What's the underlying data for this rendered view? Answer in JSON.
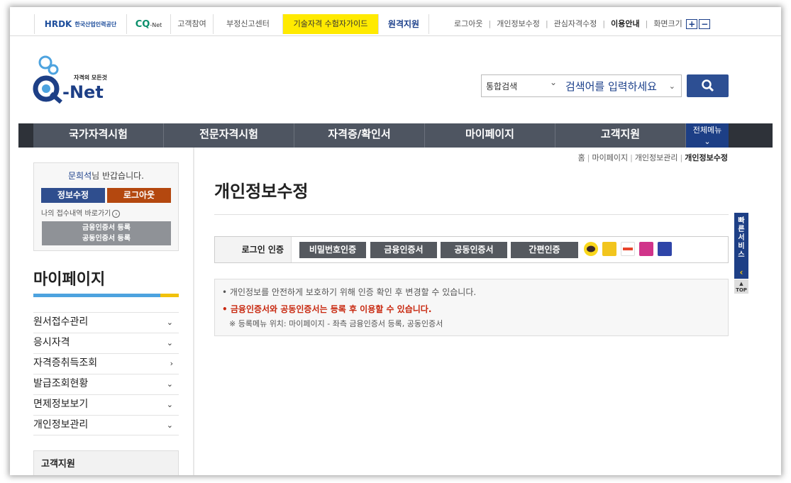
{
  "topbar": {
    "hrdk_mark": "HRDK",
    "hrdk_name": "한국산업인력공단",
    "cqnet": "CQ",
    "cqnet_suffix": "-Net",
    "links": [
      "고객참여",
      "부정신고센터"
    ],
    "guide": "기술자격 수험자가이드",
    "onsite": "원격지원",
    "util": [
      "로그아웃",
      "개인정보수정",
      "관심자격수정"
    ],
    "util_bold": "이용안내",
    "zoom_label": "화면크기",
    "zoom_in": "+",
    "zoom_out": "−"
  },
  "header": {
    "logo_tagline": "자격의 모든것",
    "logo_text": "-Net",
    "search_category": "통합검색",
    "search_placeholder": "검색어를 입력하세요"
  },
  "gnb": {
    "items": [
      "국가자격시험",
      "전문자격시험",
      "자격증/확인서",
      "마이페이지",
      "고객지원"
    ],
    "all_menu": "전체메뉴"
  },
  "userbox": {
    "user_name": "문희석",
    "greeting": "님 반갑습니다.",
    "info_button": "정보수정",
    "logout_button": "로그아웃",
    "goto_text": "나의 접수내역 바로가기",
    "cert_line1": "금융인증서 등록",
    "cert_line2": "공동인증서 등록"
  },
  "sidebar": {
    "title": "마이페이지",
    "items": [
      {
        "label": "원서접수관리",
        "arrow": "⌄"
      },
      {
        "label": "응시자격",
        "arrow": "⌄"
      },
      {
        "label": "자격증취득조회",
        "arrow": "›"
      },
      {
        "label": "발급조회현황",
        "arrow": "⌄"
      },
      {
        "label": "면제정보보기",
        "arrow": "⌄"
      },
      {
        "label": "개인정보관리",
        "arrow": "⌄"
      }
    ],
    "cs_title": "고객지원"
  },
  "breadcrumb": {
    "items": [
      "홈",
      "마이페이지",
      "개인정보관리"
    ],
    "current": "개인정보수정"
  },
  "main": {
    "title": "개인정보수정",
    "auth_label": "로그인 인증",
    "auth_buttons": [
      "비밀번호인증",
      "금융인증서",
      "공동인증서",
      "간편인증"
    ],
    "auth_icons": [
      "kakao-icon",
      "kb-icon",
      "payco-icon",
      "pass-icon",
      "samsung-pass-icon"
    ],
    "notice1": "개인정보를 안전하게 보호하기 위해 인증 확인 후 변경할 수 있습니다.",
    "notice2": "금융인증서와 공동인증서는 등록 후 이용할 수 있습니다.",
    "notice3": "※ 등록메뉴 위치: 마이페이지 - 좌측 금융인증서 등록, 공동인증서"
  },
  "quick": {
    "label": "빠른서비스",
    "arrow": "‹",
    "top": "TOP"
  },
  "colors": {
    "brand_blue": "#1d3f86",
    "gnb_gray": "#4e5561",
    "logout_orange": "#b4480f",
    "guide_yellow": "#ffea00",
    "notice_red": "#c8280f"
  }
}
